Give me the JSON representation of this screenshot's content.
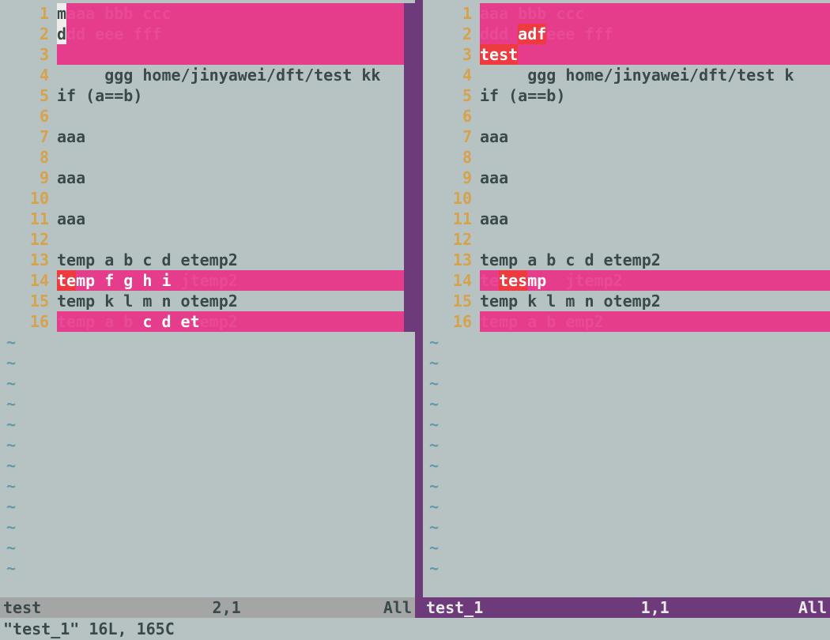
{
  "left": {
    "filename": "test",
    "cursor": "2,1",
    "scroll": "All",
    "lines": {
      "1": {
        "cur": "m",
        "rest": "aaa bbb ccc"
      },
      "2": {
        "cur": "d",
        "rest": "dd eee fff"
      },
      "3": "",
      "4": "     ggg home/jinyawei/dft/test kk",
      "5": "if (a==b)",
      "6": "",
      "7": "aaa",
      "8": "",
      "9": "aaa",
      "10": "",
      "11": "aaa",
      "12": "",
      "13": "temp a b c d etemp2",
      "14": {
        "a": "te",
        "b": "mp f g h i ",
        "c": "jtemp2"
      },
      "15": "temp k l m n otemp2",
      "16": {
        "a": "temp a b ",
        "b": "c d et",
        "c": "emp2"
      }
    },
    "linenos": [
      "1",
      "2",
      "3",
      "4",
      "5",
      "6",
      "7",
      "8",
      "9",
      "10",
      "11",
      "12",
      "13",
      "14",
      "15",
      "16"
    ]
  },
  "right": {
    "filename": "test_1",
    "cursor": "1,1",
    "scroll": "All",
    "lines": {
      "1": "aaa bbb ccc",
      "2": {
        "a": "ddd ",
        "b": "adf",
        "c": "eee fff"
      },
      "3": "test",
      "4": "     ggg home/jinyawei/dft/test k",
      "5": "if (a==b)",
      "6": "",
      "7": "aaa",
      "8": "",
      "9": "aaa",
      "10": "",
      "11": "aaa",
      "12": "",
      "13": "temp a b c d etemp2",
      "14": {
        "a": "te",
        "b": "tes",
        "c": "mp  ",
        "d": "jtemp2"
      },
      "15": "temp k l m n otemp2",
      "16": "temp a b emp2"
    },
    "linenos": [
      "1",
      "2",
      "3",
      "4",
      "5",
      "6",
      "7",
      "8",
      "9",
      "10",
      "11",
      "12",
      "13",
      "14",
      "15",
      "16"
    ]
  },
  "footer": "\"test_1\" 16L, 165C",
  "tilde": "~"
}
